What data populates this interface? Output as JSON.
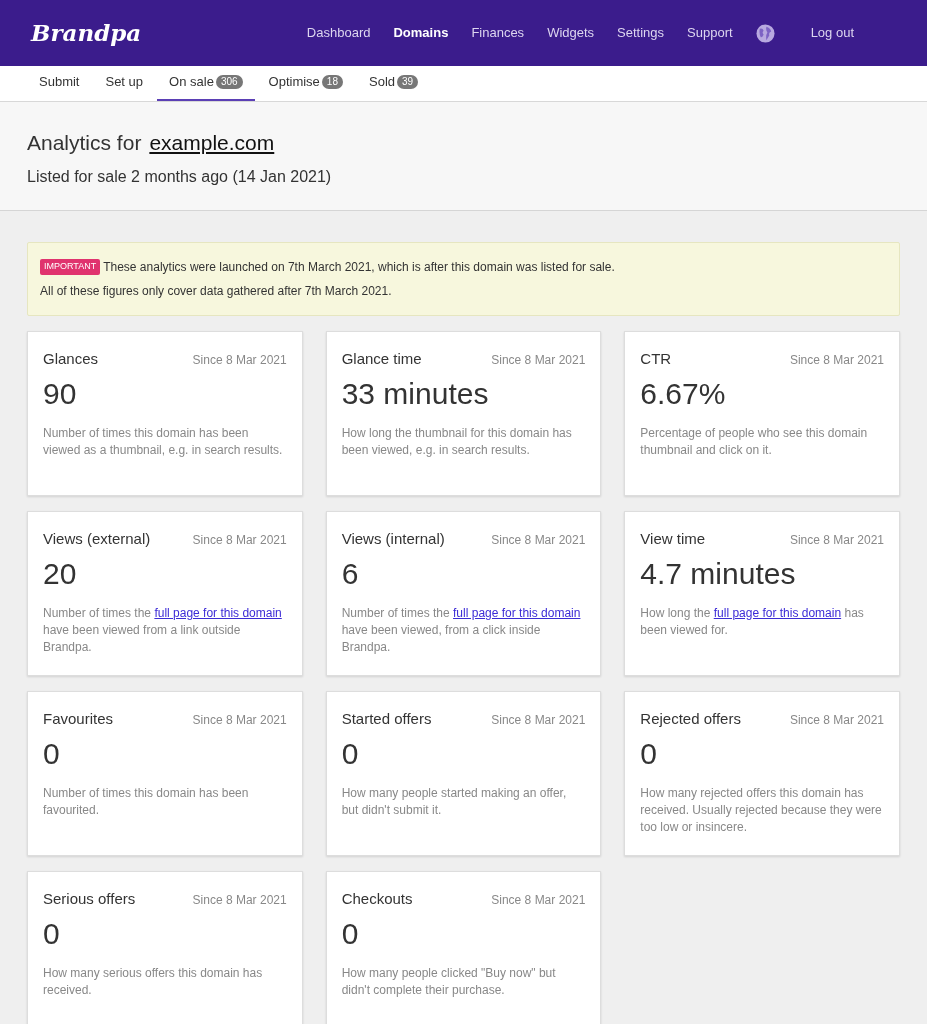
{
  "header": {
    "logo": "Brandpa",
    "nav": [
      {
        "label": "Dashboard",
        "selected": false
      },
      {
        "label": "Domains",
        "selected": true
      },
      {
        "label": "Finances",
        "selected": false
      },
      {
        "label": "Widgets",
        "selected": false
      },
      {
        "label": "Settings",
        "selected": false
      },
      {
        "label": "Support",
        "selected": false
      }
    ],
    "logout": "Log out"
  },
  "tabs": [
    {
      "label": "Submit",
      "selected": false
    },
    {
      "label": "Set up",
      "selected": false
    },
    {
      "label": "On sale",
      "count": "306",
      "selected": true
    },
    {
      "label": "Optimise",
      "count": "18",
      "selected": false
    },
    {
      "label": "Sold",
      "count": "39",
      "selected": false
    }
  ],
  "page_header": {
    "title": "Analytics for",
    "domain": "example.com",
    "subtitle": "Listed for sale 2 months ago (14 Jan 2021)"
  },
  "notice": {
    "badge": "IMPORTANT",
    "lines": [
      "These analytics were launched on 7th March 2021, which is after this domain was listed for sale.",
      "All of these figures only cover data gathered after 7th March 2021."
    ]
  },
  "cards": [
    {
      "title": "Glances",
      "since": "Since 8 Mar 2021",
      "value": "90",
      "description": [
        {
          "kind": "text",
          "text": "Number of times this domain has been viewed as a thumbnail, e.g. in search results."
        }
      ]
    },
    {
      "title": "Glance time",
      "since": "Since 8 Mar 2021",
      "value": "33 minutes",
      "description": [
        {
          "kind": "text",
          "text": "How long the thumbnail for this domain has been viewed, e.g. in search results."
        }
      ]
    },
    {
      "title": "CTR",
      "since": "Since 8 Mar 2021",
      "value": "6.67%",
      "description": [
        {
          "kind": "text",
          "text": "Percentage of people who see this domain thumbnail and click on it."
        }
      ]
    },
    {
      "title": "Views (external)",
      "since": "Since 8 Mar 2021",
      "value": "20",
      "description": [
        {
          "kind": "text",
          "text": "Number of times the "
        },
        {
          "kind": "link",
          "text": "full page for this domain"
        },
        {
          "kind": "text",
          "text": " have been viewed from a link outside Brandpa."
        }
      ]
    },
    {
      "title": "Views (internal)",
      "since": "Since 8 Mar 2021",
      "value": "6",
      "description": [
        {
          "kind": "text",
          "text": "Number of times the "
        },
        {
          "kind": "link",
          "text": "full page for this domain"
        },
        {
          "kind": "text",
          "text": " have been viewed, from a click inside Brandpa."
        }
      ]
    },
    {
      "title": "View time",
      "since": "Since 8 Mar 2021",
      "value": "4.7 minutes",
      "description": [
        {
          "kind": "text",
          "text": "How long the "
        },
        {
          "kind": "link",
          "text": "full page for this domain"
        },
        {
          "kind": "text",
          "text": " has been viewed for."
        }
      ]
    },
    {
      "title": "Favourites",
      "since": "Since 8 Mar 2021",
      "value": "0",
      "description": [
        {
          "kind": "text",
          "text": "Number of times this domain has been favourited."
        }
      ]
    },
    {
      "title": "Started offers",
      "since": "Since 8 Mar 2021",
      "value": "0",
      "description": [
        {
          "kind": "text",
          "text": "How many people started making an offer, but didn't submit it."
        }
      ]
    },
    {
      "title": "Rejected offers",
      "since": "Since 8 Mar 2021",
      "value": "0",
      "description": [
        {
          "kind": "text",
          "text": "How many rejected offers this domain has received. Usually rejected because they were too low or insincere."
        }
      ]
    },
    {
      "title": "Serious offers",
      "since": "Since 8 Mar 2021",
      "value": "0",
      "description": [
        {
          "kind": "text",
          "text": "How many serious offers this domain has received."
        }
      ]
    },
    {
      "title": "Checkouts",
      "since": "Since 8 Mar 2021",
      "value": "0",
      "description": [
        {
          "kind": "text",
          "text": "How many people clicked \"Buy now\" but didn't complete their purchase."
        }
      ]
    }
  ]
}
